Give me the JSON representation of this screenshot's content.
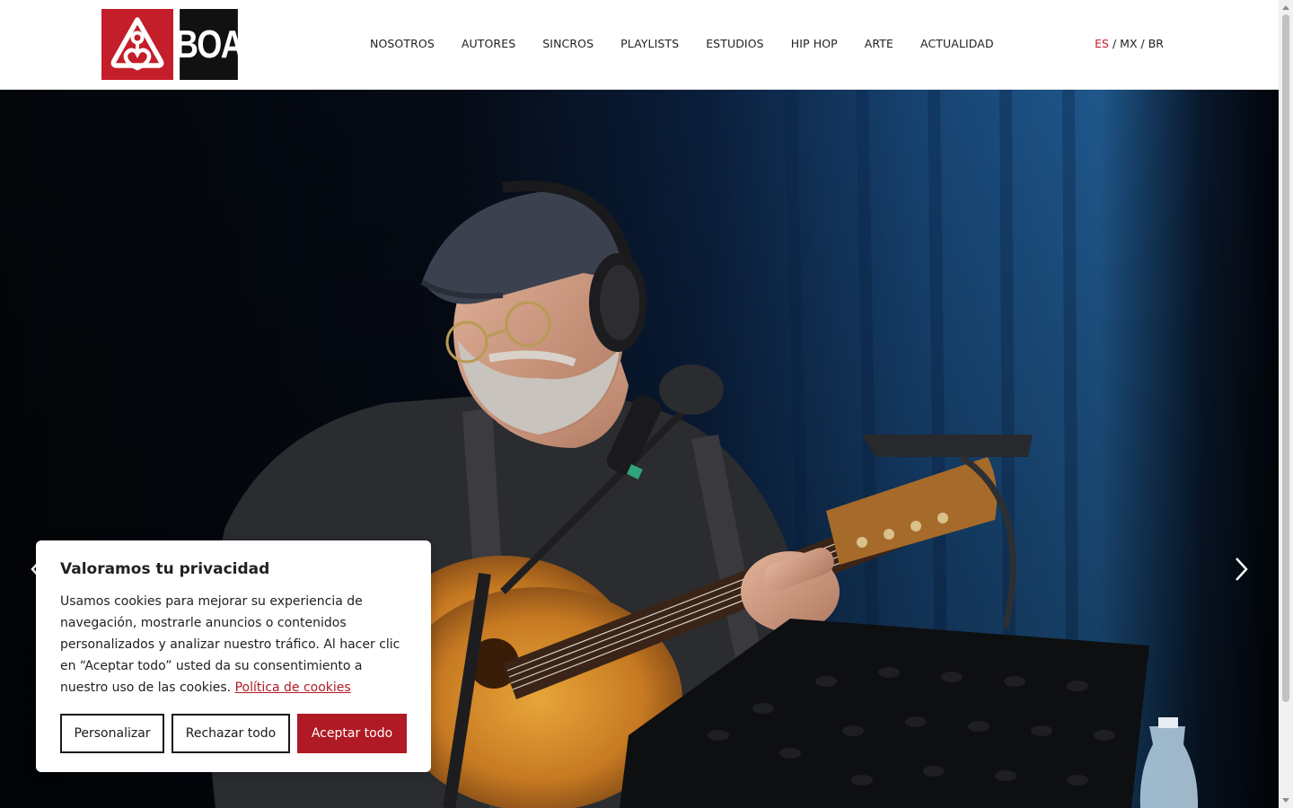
{
  "header": {
    "logo": {
      "text": "BOA",
      "colors": {
        "red": "#c41e2a",
        "black": "#111111"
      },
      "icon": "boa-emblem-icon"
    },
    "nav": [
      {
        "label": "NOSOTROS"
      },
      {
        "label": "AUTORES"
      },
      {
        "label": "SINCROS"
      },
      {
        "label": "PLAYLISTS"
      },
      {
        "label": "ESTUDIOS"
      },
      {
        "label": "HIP HOP"
      },
      {
        "label": "ARTE"
      },
      {
        "label": "ACTUALIDAD"
      }
    ],
    "languages": {
      "active": "ES",
      "separator": "/",
      "others": [
        "MX",
        "BR"
      ],
      "active_color": "#c41e2a"
    }
  },
  "hero": {
    "image": "guitarist-performing-on-stage-photo",
    "prev_icon": "chevron-left-icon",
    "next_icon": "chevron-right-icon"
  },
  "cookie_banner": {
    "title": "Valoramos tu privacidad",
    "body": "Usamos cookies para mejorar su experiencia de navegación, mostrarle anuncios o contenidos personalizados y analizar nuestro tráfico. Al hacer clic en “Aceptar todo” usted da su consentimiento a nuestro uso de las cookies.",
    "policy_link": "Política de cookies",
    "buttons": {
      "customize": "Personalizar",
      "reject": "Rechazar todo",
      "accept": "Aceptar todo"
    },
    "accent_color": "#b01a24"
  }
}
